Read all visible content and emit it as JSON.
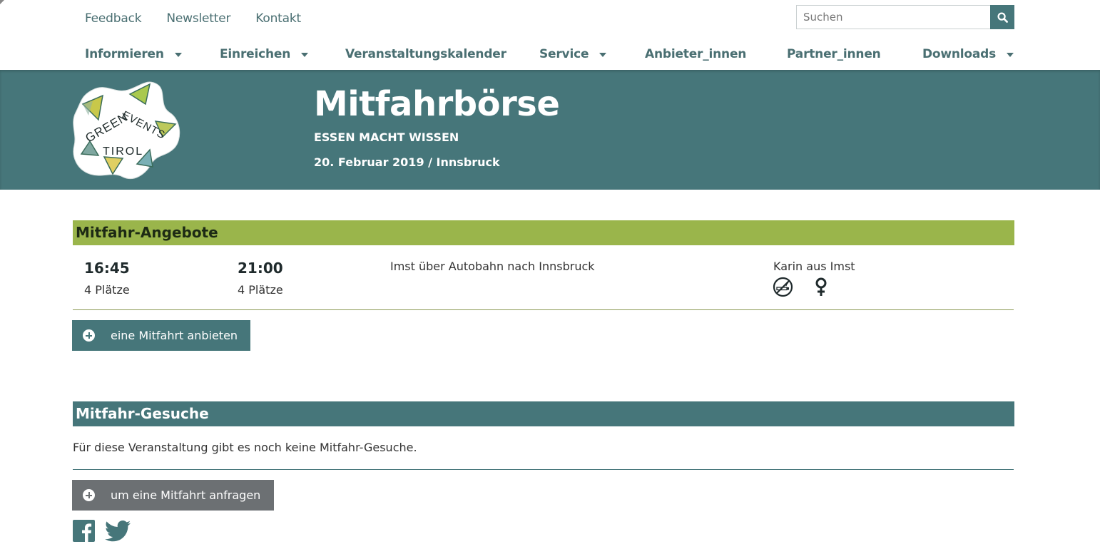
{
  "utility_nav": [
    "Feedback",
    "Newsletter",
    "Kontakt"
  ],
  "search": {
    "placeholder": "Suchen",
    "icon": "search-icon"
  },
  "main_nav": [
    {
      "label": "Informieren",
      "dropdown": true
    },
    {
      "label": "Einreichen",
      "dropdown": true
    },
    {
      "label": "Veranstaltungskalender",
      "dropdown": false
    },
    {
      "label": "Service",
      "dropdown": true
    },
    {
      "label": "Anbieter_innen",
      "dropdown": false
    },
    {
      "label": "Partner_innen",
      "dropdown": false
    },
    {
      "label": "Downloads",
      "dropdown": true
    }
  ],
  "header": {
    "logo_alt": "GREEN EVENTS TIROL",
    "title": "Mitfahrbörse",
    "subtitle": "ESSEN MACHT WISSEN",
    "dateline": "20. Februar 2019 / Innsbruck"
  },
  "offers": {
    "heading": "Mitfahr-Angebote",
    "rows": [
      {
        "departure_time": "16:45",
        "departure_seats": "4 Plätze",
        "return_time": "21:00",
        "return_seats": "4 Plätze",
        "route": "Imst über Autobahn nach Innsbruck",
        "driver": "Karin aus Imst",
        "icons": [
          "no-smoking-icon",
          "female-icon"
        ]
      }
    ],
    "button_label": "eine Mitfahrt anbieten"
  },
  "requests": {
    "heading": "Mitfahr-Gesuche",
    "empty_message": "Für diese Veranstaltung gibt es noch keine Mitfahr-Gesuche.",
    "button_label": "um eine Mitfahrt anfragen"
  },
  "social": [
    "facebook-icon",
    "twitter-icon"
  ],
  "colors": {
    "primary_teal": "#46767a",
    "offer_green": "#9ab54b",
    "request_button_gray": "#6c7073",
    "nav_text": "#4a6f72"
  }
}
